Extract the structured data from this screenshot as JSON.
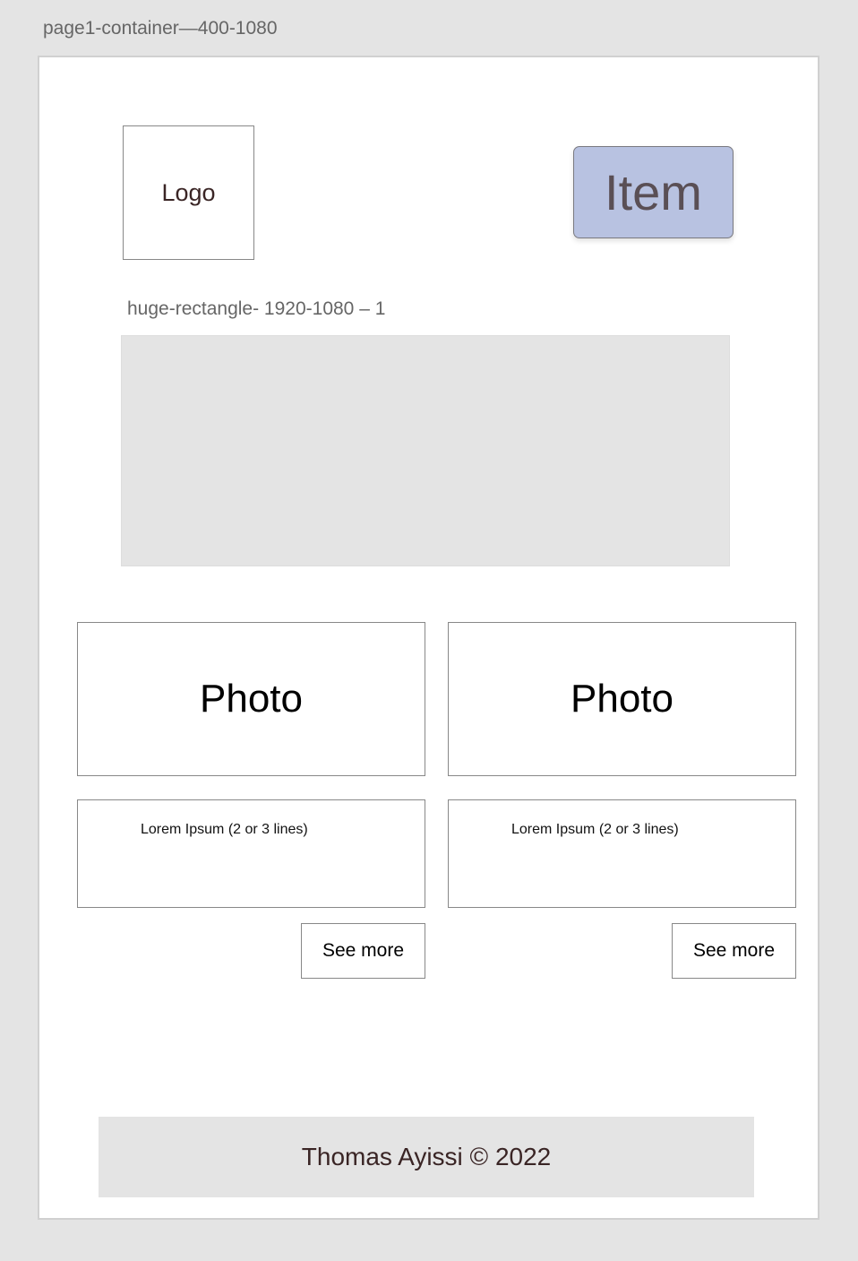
{
  "artboard": {
    "label": "page1-container—400-1080"
  },
  "header": {
    "logo": "Logo",
    "nav_item": "Item",
    "nav_item_color": "#b8c2e1"
  },
  "hero": {
    "label": "huge-rectangle- 1920-1080 – 1"
  },
  "cards": [
    {
      "photo": "Photo",
      "description": "Lorem Ipsum (2 or 3 lines)",
      "button": "See more"
    },
    {
      "photo": "Photo",
      "description": "Lorem Ipsum (2 or 3 lines)",
      "button": "See more"
    }
  ],
  "footer": {
    "text": "Thomas Ayissi © 2022"
  }
}
